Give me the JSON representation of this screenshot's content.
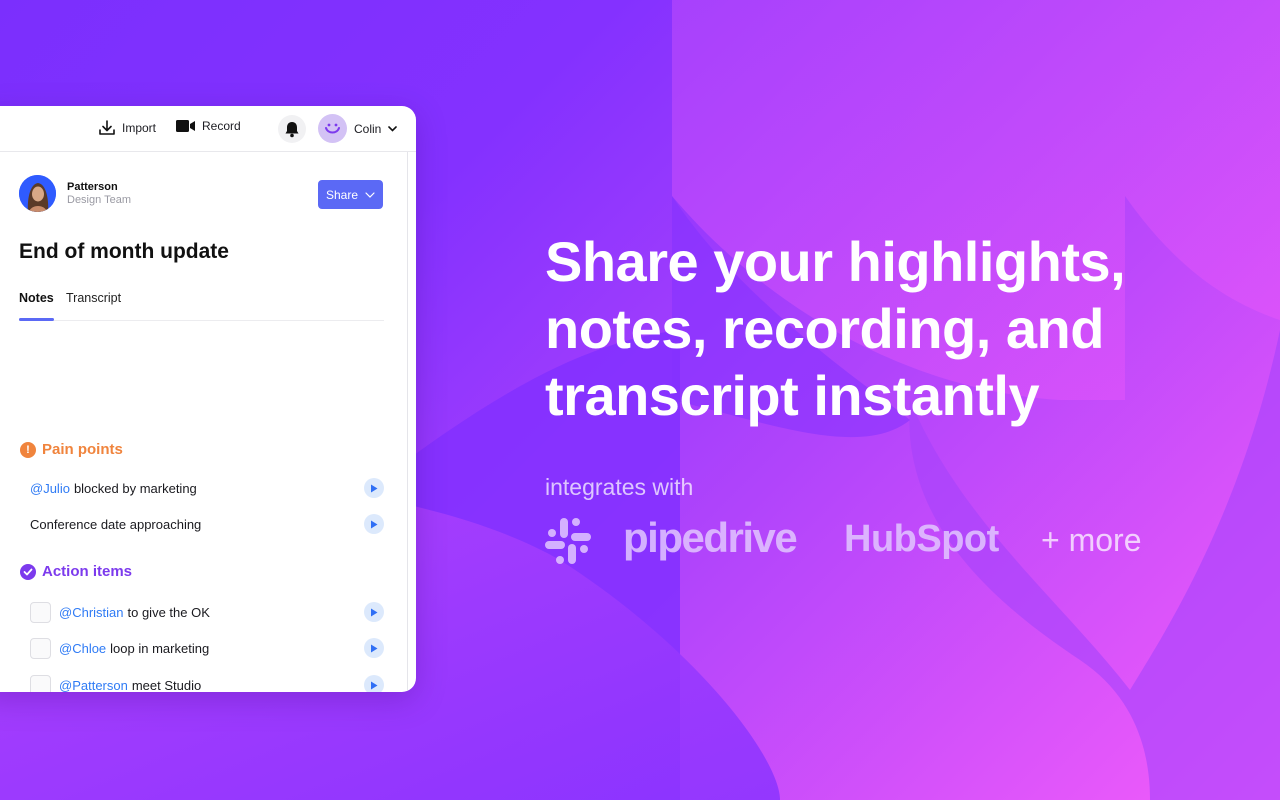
{
  "colors": {
    "brand_purple": "#8431ff",
    "accent_pink": "#f45dfa",
    "share_button": "#5b69f5",
    "pain_points": "#f0843d",
    "action_items": "#7c3aed",
    "mention": "#2f7bf5"
  },
  "toolbar": {
    "import_label": "Import",
    "import_icon": "download-icon",
    "record_label": "Record",
    "record_icon": "video-camera-icon",
    "notifications_icon": "bell-icon",
    "user_name": "Colin",
    "user_avatar_icon": "smiley-icon"
  },
  "document": {
    "owner_name": "Patterson",
    "owner_team": "Design Team",
    "share_label": "Share",
    "title": "End of month update",
    "tabs": [
      {
        "label": "Notes",
        "active": true
      },
      {
        "label": "Transcript",
        "active": false
      }
    ],
    "sections": [
      {
        "title": "Pain points",
        "icon": "exclamation-icon",
        "items": [
          {
            "mention": "@Julio",
            "text": "blocked by marketing"
          },
          {
            "mention": "",
            "text": "Conference date approaching"
          }
        ]
      },
      {
        "title": "Action items",
        "icon": "check-circle-icon",
        "items": [
          {
            "mention": "@Christian",
            "text": "to give the OK",
            "checked": false
          },
          {
            "mention": "@Chloe",
            "text": "loop in marketing",
            "checked": false
          },
          {
            "mention": "@Patterson",
            "text": "meet Studio",
            "checked": false
          }
        ]
      }
    ]
  },
  "hero": {
    "headline": "Share your highlights, notes, recording, and transcript instantly",
    "integrates_label": "integrates with",
    "integrations": [
      "Slack",
      "pipedrive",
      "HubSpot"
    ],
    "more_label": "+ more"
  }
}
